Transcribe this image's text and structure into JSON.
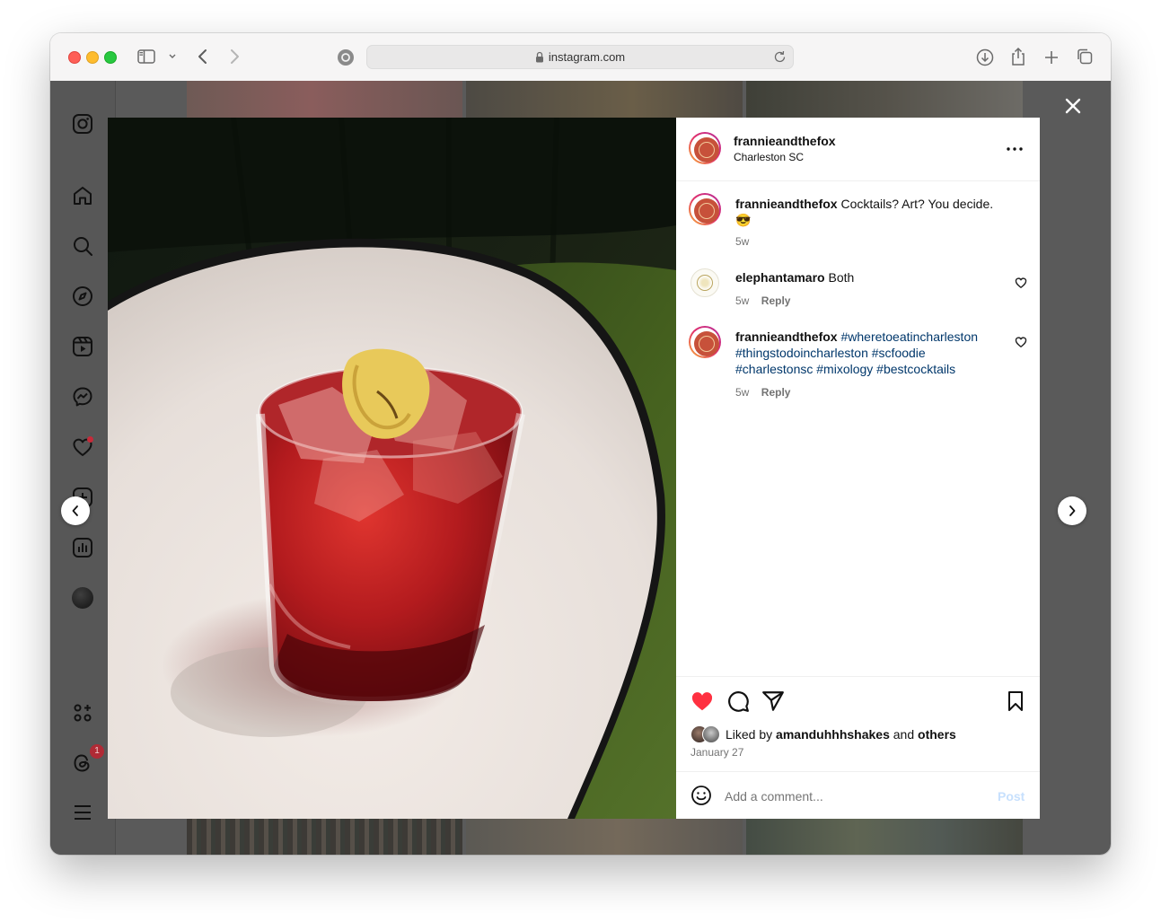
{
  "browser": {
    "url": "instagram.com"
  },
  "post": {
    "author": "frannieandthefox",
    "location": "Charleston SC",
    "caption_user": "frannieandthefox",
    "caption_text": "Cocktails? Art? You decide.",
    "caption_emoji": "😎",
    "caption_time": "5w",
    "comments": [
      {
        "user": "elephantamaro",
        "text": "Both",
        "time": "5w",
        "reply_label": "Reply"
      },
      {
        "user": "frannieandthefox",
        "tags_line1": "#wheretoeatincharleston",
        "tags_line2": "#thingstodoincharleston #scfoodie",
        "tags_line3": "#charlestonsc #mixology #bestcocktails",
        "time": "5w",
        "reply_label": "Reply"
      }
    ],
    "liked_by_prefix": "Liked by",
    "liked_by_user": "amanduhhhshakes",
    "liked_by_and": "and",
    "liked_by_others": "others",
    "date": "January 27",
    "add_comment_placeholder": "Add a comment...",
    "post_label": "Post",
    "liked": true
  },
  "sidebar": {
    "notification_badge": "1"
  },
  "colors": {
    "like_red": "#ff3040",
    "hashtag_blue": "#00376b",
    "post_disabled": "#c7e0fd"
  }
}
